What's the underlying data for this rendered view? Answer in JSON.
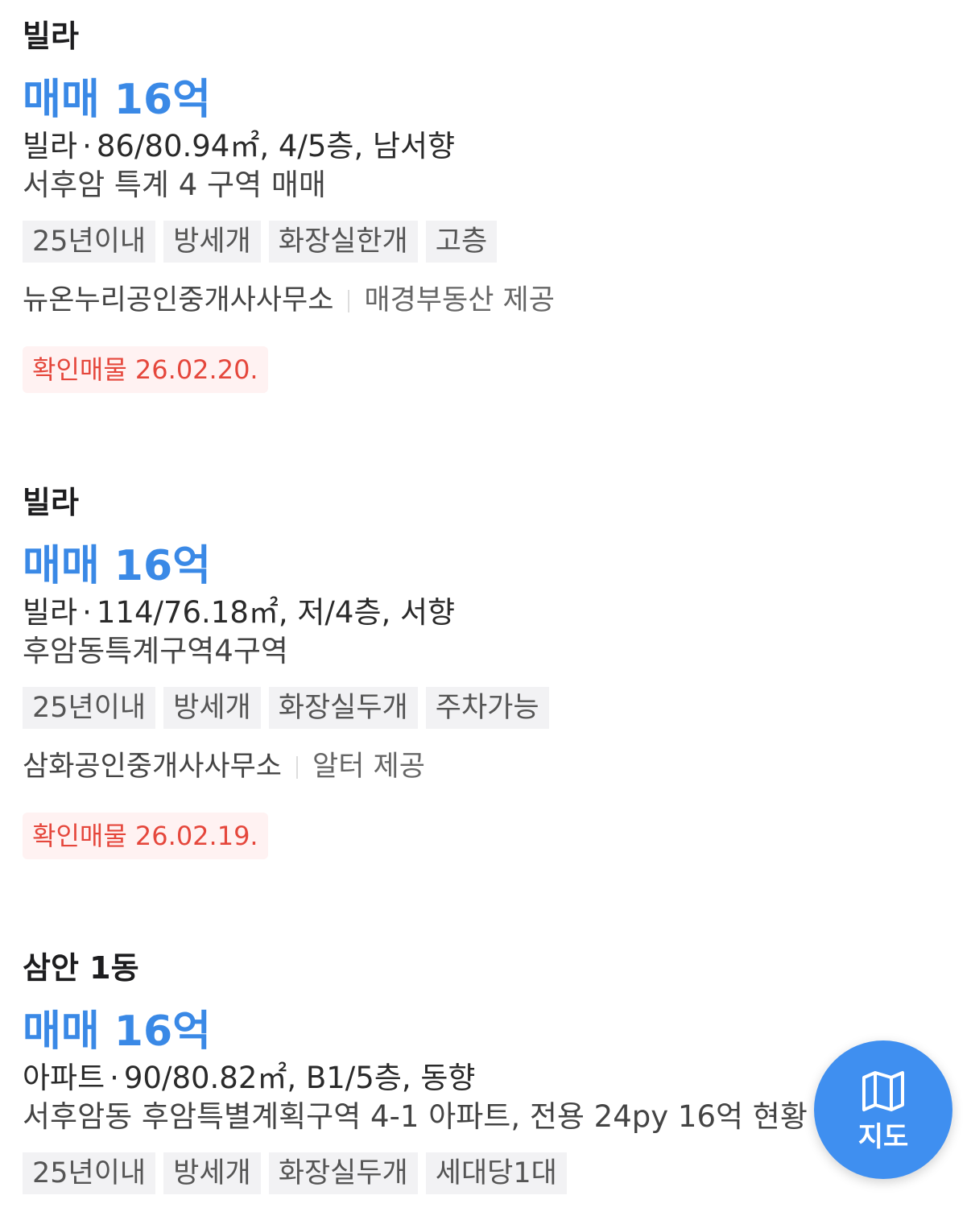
{
  "listings": [
    {
      "title": "빌라",
      "price": "매매 16억",
      "spec_type": "빌라",
      "spec_detail": "86/80.94㎡, 4/5층, 남서향",
      "description": "서후암 특계 4 구역 매매",
      "tags": [
        "25년이내",
        "방세개",
        "화장실한개",
        "고층"
      ],
      "agent": "뉴온누리공인중개사사무소",
      "provider": "매경부동산 제공",
      "verified": "확인매물 26.02.20."
    },
    {
      "title": "빌라",
      "price": "매매 16억",
      "spec_type": "빌라",
      "spec_detail": "114/76.18㎡, 저/4층, 서향",
      "description": "후암동특계구역4구역",
      "tags": [
        "25년이내",
        "방세개",
        "화장실두개",
        "주차가능"
      ],
      "agent": "삼화공인중개사사무소",
      "provider": "알터 제공",
      "verified": "확인매물 26.02.19."
    },
    {
      "title": "삼안 1동",
      "price": "매매 16억",
      "spec_type": "아파트",
      "spec_detail": "90/80.82㎡, B1/5층, 동향",
      "description": "서후암동 후암특별계획구역 4-1 아파트, 전용 24py 16억 현황",
      "tags": [
        "25년이내",
        "방세개",
        "화장실두개",
        "세대당1대"
      ]
    }
  ],
  "map_button": {
    "label": "지도",
    "icon": "map-icon",
    "color": "#3f8ff0"
  },
  "colors": {
    "price": "#3a89e6",
    "verified_text": "#e5473c",
    "verified_bg": "#fff2f2",
    "tag_bg": "#f2f2f4"
  }
}
